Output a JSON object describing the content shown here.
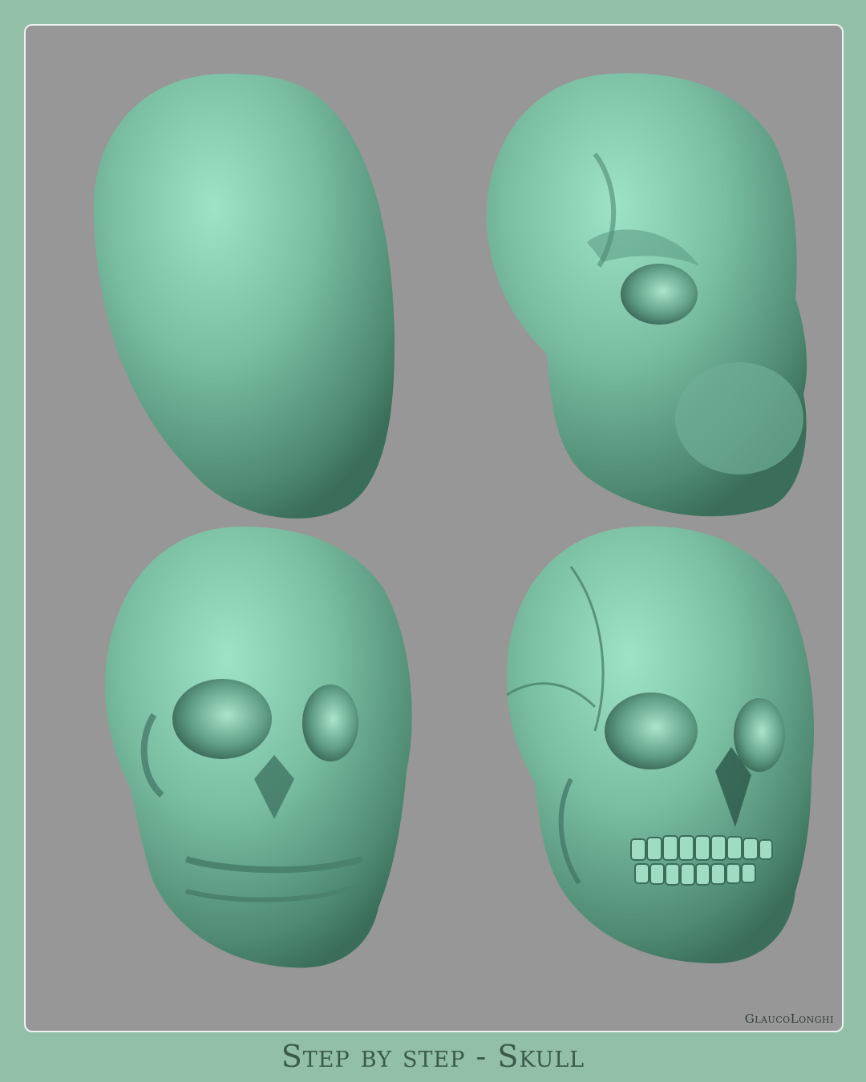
{
  "credit": "GlaucoLonghi",
  "title": "Step by step - Skull",
  "steps": [
    {
      "stage": "base-egg"
    },
    {
      "stage": "rough-planes"
    },
    {
      "stage": "refined-forms"
    },
    {
      "stage": "final-detail"
    }
  ],
  "colors": {
    "frame": "#93bfa9",
    "panel": "#979797",
    "sculpt": "#7fbfa3"
  }
}
